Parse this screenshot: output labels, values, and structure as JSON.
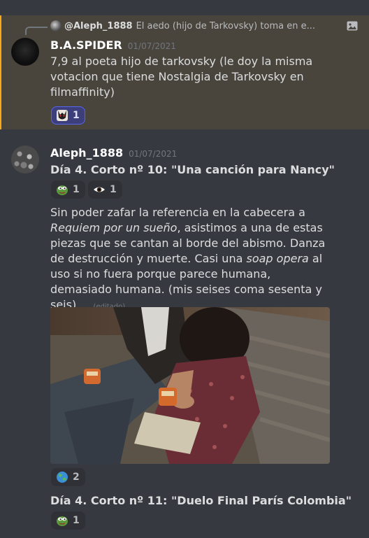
{
  "reply": {
    "author": "@Aleph_1888",
    "text": "El aedo (hijo de Tarkovsky) toma en e..."
  },
  "messages": [
    {
      "author": "B.A.SPIDER",
      "timestamp": "01/07/2021",
      "text": "7,9 al poeta hijo de tarkovsky (le doy la misma votacion  que tiene Nostalgia de Tarkovsky en filmaffinity)",
      "reactions": [
        {
          "emoji": "wolverine-emoji",
          "count": "1",
          "me": true
        }
      ]
    },
    {
      "author": "Aleph_1888",
      "timestamp": "01/07/2021",
      "title1": "Día 4. Corto nº 10: \"Una canción para Nancy\"",
      "reactions1": [
        {
          "emoji": "pepe-emoji",
          "count": "1"
        },
        {
          "emoji": "eye-emoji",
          "count": "1"
        }
      ],
      "body": {
        "p1": "Sin poder zafar la referencia en la cabecera a ",
        "i1": "Requiem por un sueño",
        "p2": ", asistimos a una de estas piezas que se cantan al borde del abismo. Danza de destrucción y muerte. Casi una ",
        "i2": "soap opera",
        "p3": " al uso si no fuera porque parece humana, demasiado humana. (mis seises coma sesenta y seis)....",
        "edited": "(editado)"
      },
      "image_reactions": [
        {
          "emoji": "earth-emoji",
          "count": "2"
        }
      ],
      "title2": "Día 4. Corto nº 11: \"Duelo Final París Colombia\"",
      "reactions2": [
        {
          "emoji": "pepe-emoji",
          "count": "1"
        }
      ]
    }
  ],
  "colors": {
    "background": "#36393f",
    "mention_highlight": "#49443c",
    "mention_border": "#faa81a",
    "reaction_me": "#3c3f7a",
    "reaction_me_border": "#5865f2"
  }
}
